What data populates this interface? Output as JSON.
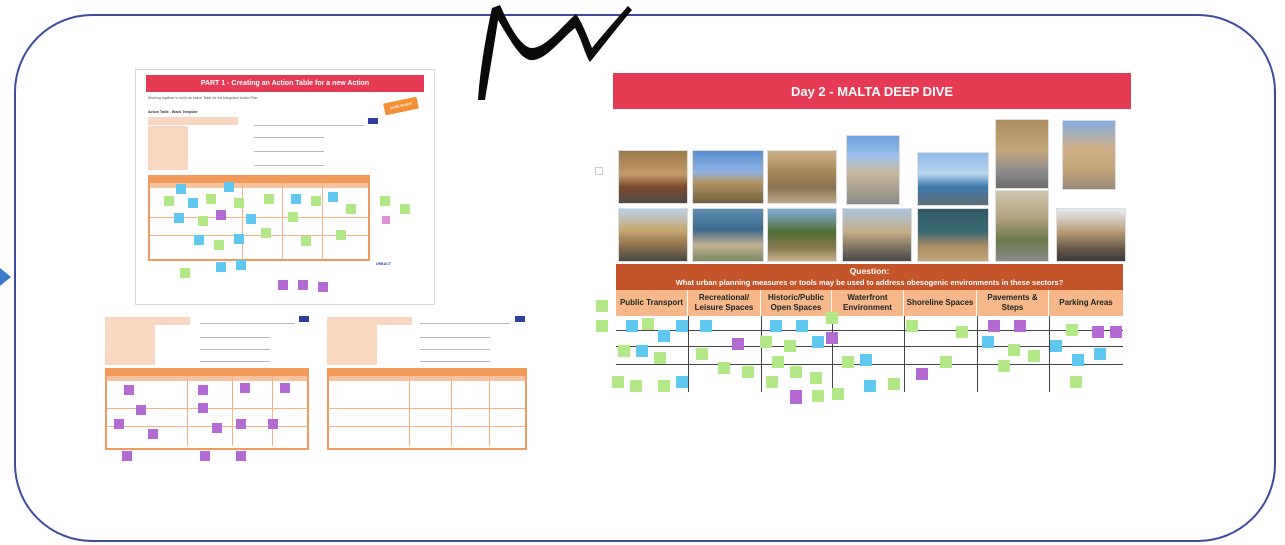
{
  "part1": {
    "title": "PART 1 - Creating an Action Table for a new Action",
    "subtitle": "Working together to build an Action Table for the Integrated Action Plan",
    "template_title": "Action Table - Blank Template",
    "tag": "CASE STUDY"
  },
  "day2": {
    "title": "Day 2 - MALTA DEEP DIVE",
    "question_title": "Question:",
    "question_text": "What urban planning measures or tools may be used to address obesogenic environments in these sectors?",
    "columns": [
      "Public Transport",
      "Recreational/ Leisure Spaces",
      "Historic/Public Open Spaces",
      "Waterfront Environment",
      "Shoreline Spaces",
      "Pavements & Steps",
      "Parking Areas"
    ]
  },
  "colors": {
    "board_border": "#3e4a9e",
    "title_red": "#e43a53",
    "question_brown": "#c5542a",
    "header_peach": "#f6b78a",
    "note_green": "#b3e889",
    "note_blue": "#5ec8f0",
    "note_purple": "#b36ad3"
  },
  "icons": {
    "scribble": "hand-drawn-scribble",
    "side_arrow": "play-triangle-icon"
  }
}
